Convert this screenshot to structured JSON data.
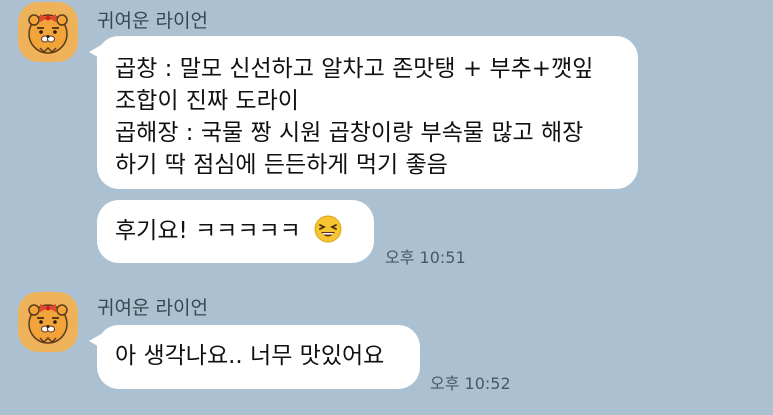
{
  "chat": {
    "messages": [
      {
        "sender": "귀여운 라이언",
        "lines": [
          "곱창 : 말모 신선하고 알차고 존맛탱 + 부추+깻잎",
          "조합이 진짜 도라이",
          "곱해장 : 국물 짱 시원 곱창이랑 부속물 많고 해장",
          "하기 딱 점심에 든든하게 먹기 좋음"
        ],
        "time": ""
      },
      {
        "sender": "",
        "lines": [
          "후기요! ㅋㅋㅋㅋㅋ"
        ],
        "emoji": "grinning-squint-emoji",
        "time": "오후 10:51"
      },
      {
        "sender": "귀여운 라이언",
        "lines": [
          "아 생각나요.. 너무 맛있어요"
        ],
        "time": "오후 10:52"
      }
    ]
  },
  "colors": {
    "background": "#abc1d1",
    "bubble": "#ffffff",
    "avatar": "#eeb35a"
  },
  "icons": {
    "avatar": "ryan-character-avatar",
    "emoji": "grinning-squint-emoji"
  }
}
